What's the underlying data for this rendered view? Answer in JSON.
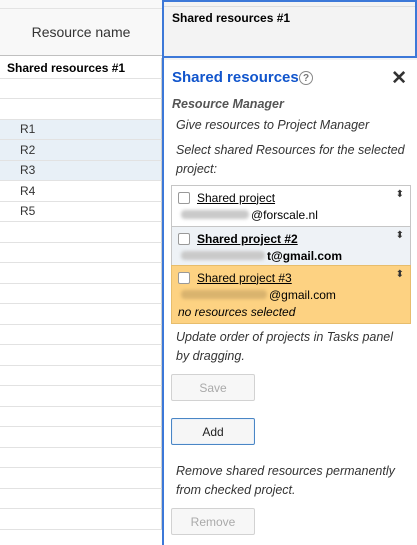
{
  "sheet": {
    "column_header": "Resource name",
    "header_row": "Shared resources #1",
    "resources": [
      "R1",
      "R2",
      "R3",
      "R4",
      "R5"
    ]
  },
  "panel": {
    "cell_title": "Shared resources #1",
    "title": "Shared resources",
    "help_icon": "?",
    "close_icon": "✕",
    "section_title": "Resource Manager",
    "give_text": "Give resources to Project Manager",
    "select_text": "Select shared Resources for the selected project:",
    "projects": [
      {
        "name": "Shared project",
        "email_suffix": "@forscale.nl",
        "note": ""
      },
      {
        "name": "Shared project #2",
        "email_suffix": "t@gmail.com",
        "note": ""
      },
      {
        "name": "Shared project #3",
        "email_suffix": "@gmail.com",
        "note": "no resources selected"
      }
    ],
    "sort_icon": "⬍",
    "order_text": "Update order of projects in Tasks panel by dragging.",
    "save_label": "Save",
    "add_label": "Add",
    "remove_text": "Remove shared resources permanently from checked project.",
    "remove_label": "Remove"
  },
  "colors": {
    "accent": "#3c78d8",
    "title": "#1155cc",
    "highlight": "#fdd282",
    "shaded_row": "#e8f0f7"
  }
}
